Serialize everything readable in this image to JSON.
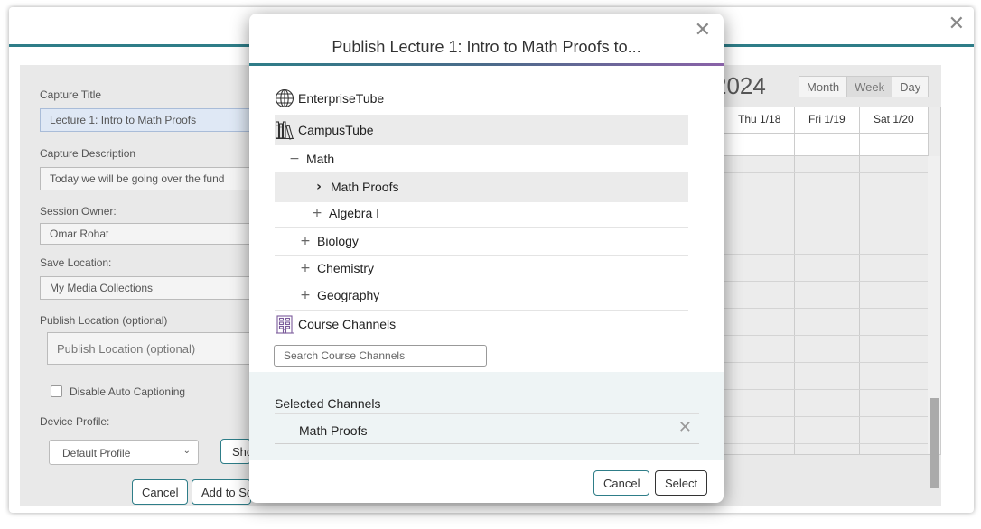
{
  "background": {
    "form": {
      "capture_title_label": "Capture Title",
      "capture_title_value": "Lecture 1: Intro to Math Proofs",
      "capture_description_label": "Capture Description",
      "capture_description_value": "Today we will be going over the fund",
      "session_owner_label": "Session Owner:",
      "session_owner_value": "Omar Rohat",
      "save_location_label": "Save Location:",
      "save_location_value": "My Media Collections",
      "publish_location_label": "Publish Location (optional)",
      "publish_location_placeholder": "Publish Location (optional)",
      "disable_auto_captioning_label": "Disable Auto Captioning",
      "device_profile_label": "Device Profile:",
      "device_profile_value": "Default Profile",
      "show_button": "Sho",
      "cancel_button": "Cancel",
      "add_button": "Add to Sc"
    },
    "calendar": {
      "year": "2024",
      "views": [
        "Month",
        "Week",
        "Day"
      ],
      "active_view": "Week",
      "days": [
        "Thu 1/18",
        "Fri 1/19",
        "Sat 1/20"
      ]
    }
  },
  "modal": {
    "title": "Publish Lecture 1: Intro to Math Proofs to...",
    "tree": {
      "enterprise": "EnterpriseTube",
      "campus": "CampusTube",
      "math": "Math",
      "math_proofs": "Math Proofs",
      "algebra": "Algebra I",
      "biology": "Biology",
      "chemistry": "Chemistry",
      "geography": "Geography",
      "course_channels": "Course Channels"
    },
    "search_placeholder": "Search Course Channels",
    "selected_label": "Selected Channels",
    "selected_items": [
      "Math Proofs"
    ],
    "cancel_button": "Cancel",
    "select_button": "Select"
  },
  "colors": {
    "accent": "#2e7d88",
    "gradient_end": "#8a62a8"
  }
}
